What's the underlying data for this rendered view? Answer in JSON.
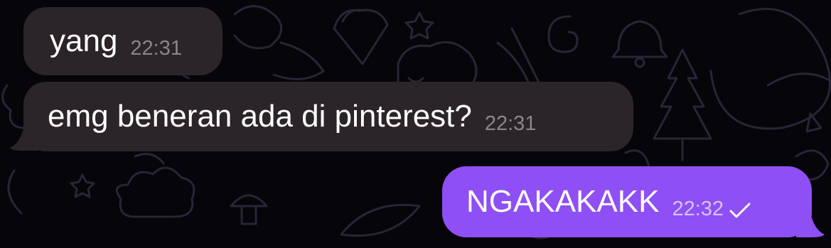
{
  "messages": [
    {
      "direction": "incoming",
      "text": "yang",
      "time": "22:31"
    },
    {
      "direction": "incoming",
      "text": "emg beneran ada di pinterest?",
      "time": "22:31"
    },
    {
      "direction": "outgoing",
      "text": "NGAKAKAKK",
      "time": "22:32",
      "status_icon": "check-icon"
    }
  ],
  "colors": {
    "background": "#060509",
    "incoming_bubble": "#2b2529",
    "outgoing_bubble": "#8e4ff4",
    "doodle": "#2a2438"
  }
}
